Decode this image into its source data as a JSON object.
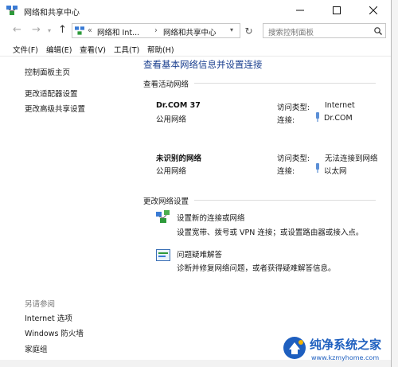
{
  "window": {
    "title": "网络和共享中心",
    "controls": [
      "minimize-icon",
      "maximize-icon",
      "close-icon"
    ]
  },
  "address": {
    "crumb_sep": "«",
    "crumb_1": "网络和 Int...",
    "crumb_arrow": "›",
    "crumb_2": "网络和共享中心",
    "search_placeholder": "搜索控制面板"
  },
  "menu": [
    "文件(F)",
    "编辑(E)",
    "查看(V)",
    "工具(T)",
    "帮助(H)"
  ],
  "sidebar": {
    "home": "控制面板主页",
    "links": [
      "更改适配器设置",
      "更改高级共享设置"
    ],
    "see_also_label": "另请参阅",
    "see_also": [
      "Internet 选项",
      "Windows 防火墙",
      "家庭组"
    ]
  },
  "main": {
    "heading": "查看基本网络信息并设置连接",
    "active_networks_label": "查看活动网络",
    "networks": [
      {
        "name": "Dr.COM  37",
        "type": "公用网络",
        "access_label": "访问类型:",
        "access_value": "Internet",
        "conn_label": "连接:",
        "conn_value": "Dr.COM"
      },
      {
        "name": "未识别的网络",
        "type": "公用网络",
        "access_label": "访问类型:",
        "access_value": "无法连接到网络",
        "conn_label": "连接:",
        "conn_value": "以太网"
      }
    ],
    "change_label": "更改网络设置",
    "tasks": [
      {
        "title": "设置新的连接或网络",
        "desc": "设置宽带、拨号或 VPN 连接；或设置路由器或接入点。"
      },
      {
        "title": "问题疑难解答",
        "desc": "诊断并修复网络问题，或者获得疑难解答信息。"
      }
    ]
  },
  "watermark": {
    "title": "纯净系统之家",
    "url": "www.kzmyhome.com"
  },
  "colors": {
    "link": "#1a4fa0",
    "accent": "#2b6fd6",
    "watermark_blue": "#1e5fbf"
  }
}
